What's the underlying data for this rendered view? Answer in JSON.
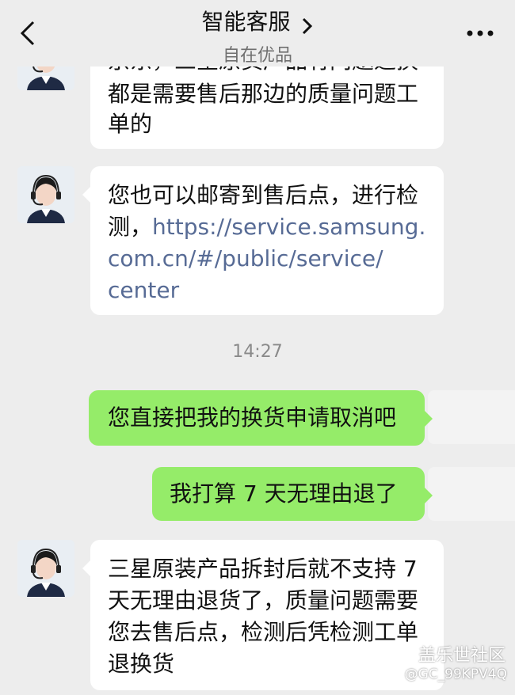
{
  "header": {
    "title": "智能客服",
    "subtitle": "自在优品"
  },
  "messages": {
    "m1": {
      "lines": [
        "京东，三星原货产品有问题退换",
        "都是需要售后那边的质量问题工",
        "单的"
      ]
    },
    "m2": {
      "line1": "您也可以邮寄到售后点，进行检",
      "line2_prefix": "测，",
      "line2_link": "https://service.samsung.",
      "line3_link": "com.cn/#/public/service/",
      "line4_link": "center"
    },
    "time": "14:27",
    "m3": {
      "text": "您直接把我的换货申请取消吧"
    },
    "m4": {
      "text": "我打算 7 天无理由退了"
    },
    "m5": {
      "lines": [
        "三星原装产品拆封后就不支持 7",
        "天无理由退货了，质量问题需要",
        "您去售后点，检测后凭检测工单",
        "退换货"
      ]
    }
  },
  "watermark": {
    "line1": "盖乐世社区",
    "line2": "@GC_99KPV4Q"
  },
  "colors": {
    "background": "#ededed",
    "incoming_bubble": "#ffffff",
    "outgoing_bubble": "#95ec69",
    "link": "#576b95"
  }
}
